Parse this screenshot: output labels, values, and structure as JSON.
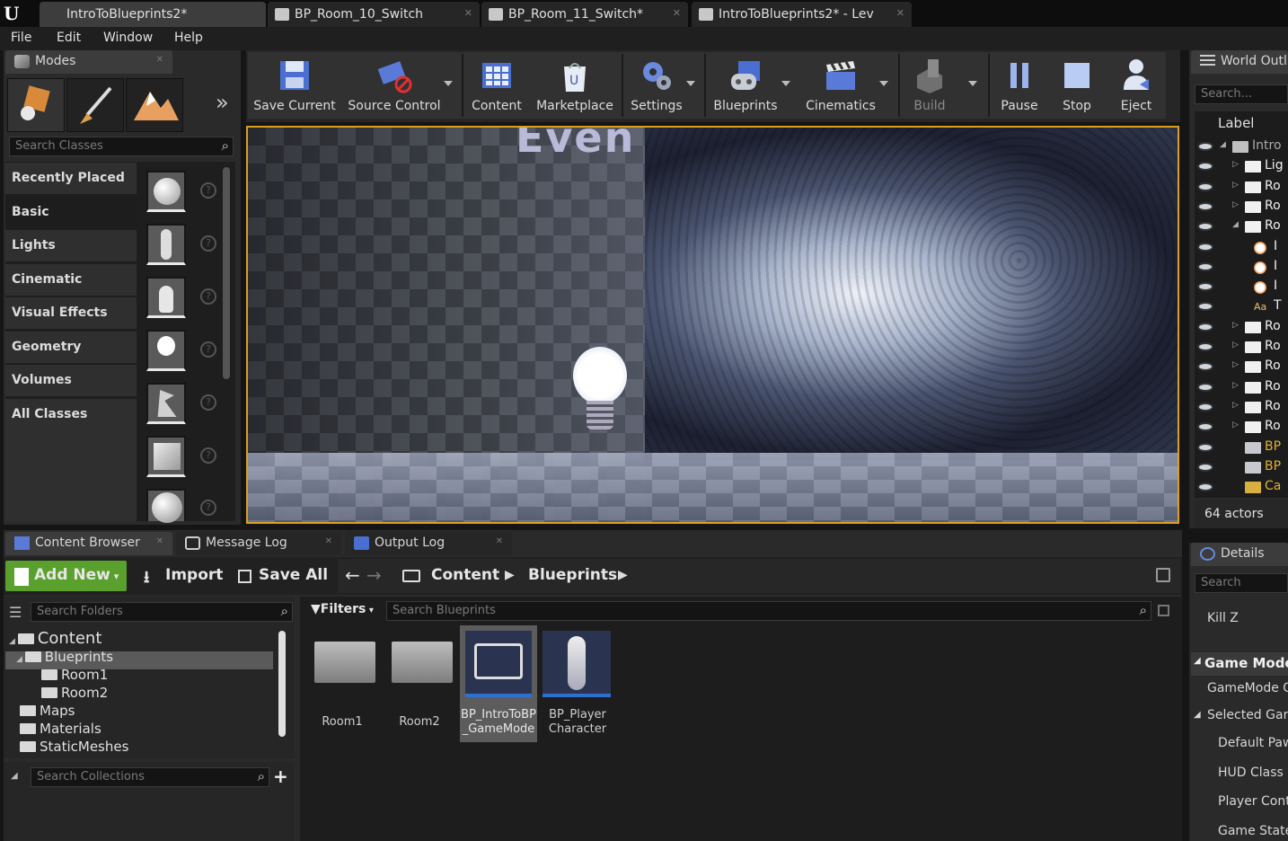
{
  "doc_tabs": [
    "IntroToBlueprints2*",
    "BP_Room_10_Switch",
    "BP_Room_11_Switch*",
    "IntroToBlueprints2* - Lev"
  ],
  "menu": [
    "File",
    "Edit",
    "Window",
    "Help"
  ],
  "modes": {
    "tab_label": "Modes",
    "search_placeholder": "Search Classes",
    "categories": [
      "Recently Placed",
      "Basic",
      "Lights",
      "Cinematic",
      "Visual Effects",
      "Geometry",
      "Volumes",
      "All Classes"
    ],
    "help_glyph": "?"
  },
  "toolbar": {
    "buttons": [
      "Save Current",
      "Source Control",
      "Content",
      "Marketplace",
      "Settings",
      "Blueprints",
      "Cinematics",
      "Build",
      "Pause",
      "Stop",
      "Eject"
    ]
  },
  "viewport": {
    "banner_text": "Even"
  },
  "outliner": {
    "tab_label": "World Outl",
    "search_placeholder": "Search...",
    "column_label": "Label",
    "rows": [
      "Intro",
      "Lig",
      "Ro",
      "Ro",
      "Ro",
      "I",
      "I",
      "I",
      "T",
      "Ro",
      "Ro",
      "Ro",
      "Ro",
      "Ro",
      "Ro",
      "BP",
      "BP",
      "Ca"
    ],
    "actor_count": "64 actors"
  },
  "bottom_tabs": [
    "Content Browser",
    "Message Log",
    "Output Log"
  ],
  "content_browser": {
    "add_new": "Add New",
    "import": "Import",
    "save_all": "Save All",
    "breadcrumb": [
      "Content",
      "Blueprints"
    ],
    "search_folders_placeholder": "Search Folders",
    "filters_label": "Filters",
    "search_assets_placeholder": "Search Blueprints",
    "search_collections_placeholder": "Search Collections",
    "tree": [
      {
        "label": "Content",
        "level": 0
      },
      {
        "label": "Blueprints",
        "level": 1
      },
      {
        "label": "Room1",
        "level": 2
      },
      {
        "label": "Room2",
        "level": 2
      },
      {
        "label": "Maps",
        "level": 1
      },
      {
        "label": "Materials",
        "level": 1
      },
      {
        "label": "StaticMeshes",
        "level": 1
      }
    ],
    "assets": [
      {
        "line1": "Room1",
        "line2": ""
      },
      {
        "line1": "Room2",
        "line2": ""
      },
      {
        "line1": "BP_IntroToBP",
        "line2": "_GameMode"
      },
      {
        "line1": "BP_Player",
        "line2": "Character"
      }
    ]
  },
  "details": {
    "tab_label": "Details",
    "search_placeholder": "Search",
    "kill_z_label": "Kill Z",
    "game_mode_header": "Game Mode",
    "game_mode_override": "GameMode O",
    "selected_game_header": "Selected Gam",
    "props": [
      "Default Paw",
      "HUD Class",
      "Player Cont",
      "Game State"
    ]
  },
  "colors": {
    "accent_green": "#5aa02c",
    "viewport_border": "#d9a020",
    "selection_blue": "#2f6fd0"
  }
}
